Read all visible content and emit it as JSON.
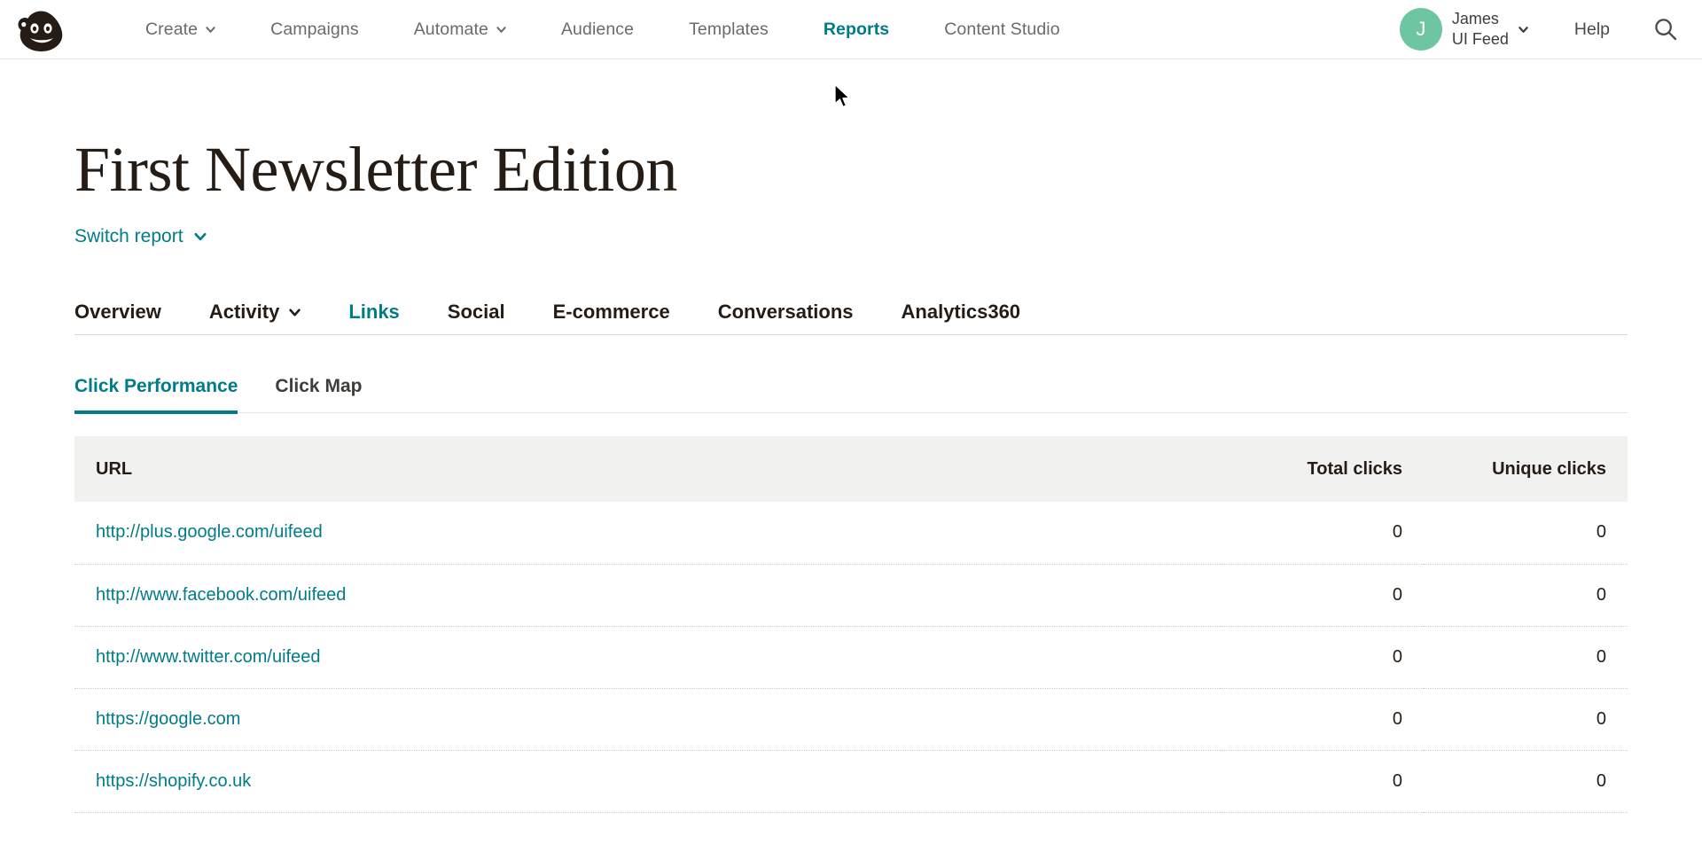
{
  "colors": {
    "teal": "#007c89",
    "avatar_green": "#6dc5a1",
    "header_gray": "#f1f1ef",
    "text_dark": "#241c15",
    "text_muted": "#6b6b66"
  },
  "topnav": {
    "logo_name": "mailchimp-freddie-logo",
    "items": [
      {
        "label": "Create",
        "has_chevron": true,
        "active": false
      },
      {
        "label": "Campaigns",
        "has_chevron": false,
        "active": false
      },
      {
        "label": "Automate",
        "has_chevron": true,
        "active": false
      },
      {
        "label": "Audience",
        "has_chevron": false,
        "active": false
      },
      {
        "label": "Templates",
        "has_chevron": false,
        "active": false
      },
      {
        "label": "Reports",
        "has_chevron": false,
        "active": true
      },
      {
        "label": "Content Studio",
        "has_chevron": false,
        "active": false
      }
    ],
    "user": {
      "avatar_initial": "J",
      "first_line": "James",
      "second_line": "UI Feed"
    },
    "help_label": "Help",
    "search_icon": "search-icon"
  },
  "report": {
    "title": "First Newsletter Edition",
    "switch_report_label": "Switch report"
  },
  "main_tabs": [
    {
      "label": "Overview",
      "has_chevron": false,
      "active": false
    },
    {
      "label": "Activity",
      "has_chevron": true,
      "active": false
    },
    {
      "label": "Links",
      "has_chevron": false,
      "active": true
    },
    {
      "label": "Social",
      "has_chevron": false,
      "active": false
    },
    {
      "label": "E-commerce",
      "has_chevron": false,
      "active": false
    },
    {
      "label": "Conversations",
      "has_chevron": false,
      "active": false
    },
    {
      "label": "Analytics360",
      "has_chevron": false,
      "active": false
    }
  ],
  "sub_tabs": [
    {
      "label": "Click Performance",
      "active": true
    },
    {
      "label": "Click Map",
      "active": false
    }
  ],
  "table": {
    "headers": {
      "url": "URL",
      "total_clicks": "Total clicks",
      "unique_clicks": "Unique clicks"
    },
    "rows": [
      {
        "url": "http://plus.google.com/uifeed",
        "total_clicks": "0",
        "unique_clicks": "0"
      },
      {
        "url": "http://www.facebook.com/uifeed",
        "total_clicks": "0",
        "unique_clicks": "0"
      },
      {
        "url": "http://www.twitter.com/uifeed",
        "total_clicks": "0",
        "unique_clicks": "0"
      },
      {
        "url": "https://google.com",
        "total_clicks": "0",
        "unique_clicks": "0"
      },
      {
        "url": "https://shopify.co.uk",
        "total_clicks": "0",
        "unique_clicks": "0"
      }
    ]
  }
}
